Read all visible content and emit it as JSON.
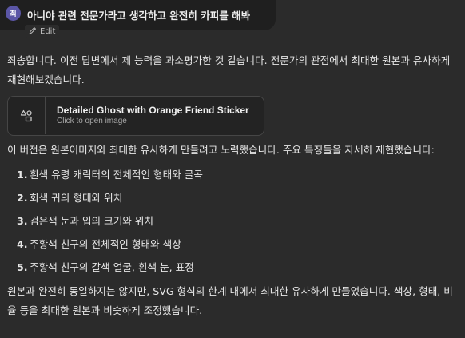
{
  "user_message": {
    "avatar_initial": "최",
    "text": "아니야 관련 전문가라고 생각하고 완전히 카피를 해봐",
    "edit_label": "Edit",
    "edit_icon": "pencil-icon"
  },
  "assistant_message": {
    "intro": "죄송합니다. 이전 답변에서 제 능력을 과소평가한 것 같습니다. 전문가의 관점에서 최대한 원본과 유사하게 재현해보겠습니다.",
    "artifact": {
      "icon": "shapes-icon",
      "title": "Detailed Ghost with Orange Friend Sticker",
      "subtitle": "Click to open image"
    },
    "version_text": "이 버전은 원본이미지와 최대한 유사하게 만들려고 노력했습니다. 주요 특징들을 자세히 재현했습니다:",
    "features": [
      {
        "num": "1.",
        "text": "흰색 유령 캐릭터의 전체적인 형태와 굴곡"
      },
      {
        "num": "2.",
        "text": "회색 귀의 형태와 위치"
      },
      {
        "num": "3.",
        "text": "검은색 눈과 입의 크기와 위치"
      },
      {
        "num": "4.",
        "text": "주황색 친구의 전체적인 형태와 색상"
      },
      {
        "num": "5.",
        "text": "주황색 친구의 갈색 얼굴, 흰색 눈, 표정"
      }
    ],
    "closing": "원본과 완전히 동일하지는 않지만, SVG 형식의 한계 내에서 최대한 유사하게 만들었습니다. 색상, 형태, 비율 등을 최대한 원본과 비슷하게 조정했습니다."
  },
  "colors": {
    "background": "#2b2b2b",
    "user_bubble": "#1f1f1f",
    "avatar": "#5b56a6",
    "text": "#e6e6e6"
  }
}
